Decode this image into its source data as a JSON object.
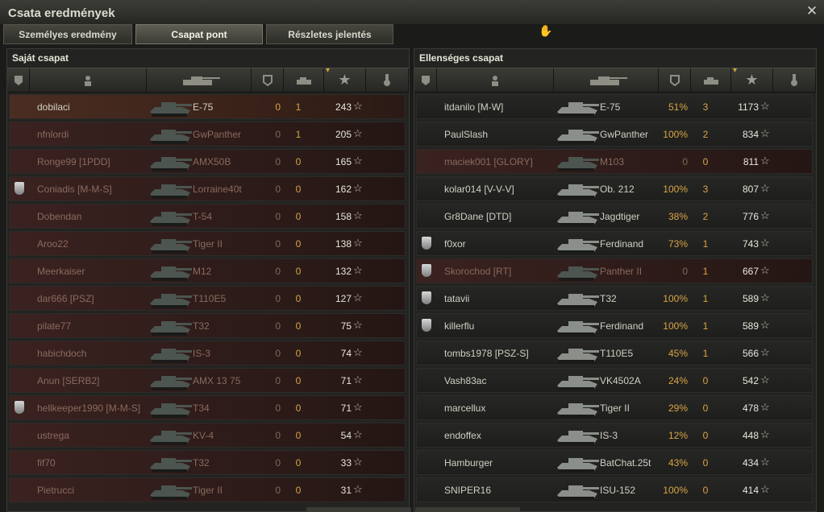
{
  "window": {
    "title": "Csata eredmények"
  },
  "tabs": [
    {
      "label": "Személyes eredmény"
    },
    {
      "label": "Csapat pont"
    },
    {
      "label": "Részletes jelentés"
    }
  ],
  "own_team": {
    "title": "Saját csapat",
    "rows": [
      {
        "player": "dobilaci",
        "tank": "E-75",
        "pct": "0",
        "kills": "1",
        "points": "243"
      },
      {
        "player": "nfnlordi",
        "tank": "GwPanther",
        "pct": "0",
        "kills": "1",
        "points": "205"
      },
      {
        "player": "Ronge99 [1PDD]",
        "tank": "AMX50B",
        "pct": "0",
        "kills": "0",
        "points": "165"
      },
      {
        "player": "Coniadis [M-M-S]",
        "tank": "Lorraine40t",
        "pct": "0",
        "kills": "0",
        "points": "162"
      },
      {
        "player": "Dobendan",
        "tank": "T-54",
        "pct": "0",
        "kills": "0",
        "points": "158"
      },
      {
        "player": "Aroo22",
        "tank": "Tiger II",
        "pct": "0",
        "kills": "0",
        "points": "138"
      },
      {
        "player": "Meerkaiser",
        "tank": "M12",
        "pct": "0",
        "kills": "0",
        "points": "132"
      },
      {
        "player": "dar666 [PSZ]",
        "tank": "T110E5",
        "pct": "0",
        "kills": "0",
        "points": "127"
      },
      {
        "player": "pilate77",
        "tank": "T32",
        "pct": "0",
        "kills": "0",
        "points": "75"
      },
      {
        "player": "habichdoch",
        "tank": "IS-3",
        "pct": "0",
        "kills": "0",
        "points": "74"
      },
      {
        "player": "Anun [SERB2]",
        "tank": "AMX 13 75",
        "pct": "0",
        "kills": "0",
        "points": "71"
      },
      {
        "player": "hellkeeper1990 [M-M-S]",
        "tank": "T34",
        "pct": "0",
        "kills": "0",
        "points": "71"
      },
      {
        "player": "ustrega",
        "tank": "KV-4",
        "pct": "0",
        "kills": "0",
        "points": "54"
      },
      {
        "player": "fif70",
        "tank": "T32",
        "pct": "0",
        "kills": "0",
        "points": "33"
      },
      {
        "player": "Pietrucci",
        "tank": "Tiger II",
        "pct": "0",
        "kills": "0",
        "points": "31"
      }
    ]
  },
  "enemy_team": {
    "title": "Ellenséges csapat",
    "rows": [
      {
        "player": "itdanilo [M-W]",
        "tank": "E-75",
        "pct": "51%",
        "kills": "3",
        "points": "1173"
      },
      {
        "player": "PaulSlash",
        "tank": "GwPanther",
        "pct": "100%",
        "kills": "2",
        "points": "834"
      },
      {
        "player": "maciek001 [GLORY]",
        "tank": "M103",
        "pct": "0",
        "kills": "0",
        "points": "811"
      },
      {
        "player": "kolar014 [V-V-V]",
        "tank": "Ob. 212",
        "pct": "100%",
        "kills": "3",
        "points": "807"
      },
      {
        "player": "Gr8Dane [DTD]",
        "tank": "Jagdtiger",
        "pct": "38%",
        "kills": "2",
        "points": "776"
      },
      {
        "player": "f0xor",
        "tank": "Ferdinand",
        "pct": "73%",
        "kills": "1",
        "points": "743"
      },
      {
        "player": "Skorochod [RT]",
        "tank": "Panther II",
        "pct": "0",
        "kills": "1",
        "points": "667"
      },
      {
        "player": "tatavii",
        "tank": "T32",
        "pct": "100%",
        "kills": "1",
        "points": "589"
      },
      {
        "player": "killerflu",
        "tank": "Ferdinand",
        "pct": "100%",
        "kills": "1",
        "points": "589"
      },
      {
        "player": "tombs1978 [PSZ-S]",
        "tank": "T110E5",
        "pct": "45%",
        "kills": "1",
        "points": "566"
      },
      {
        "player": "Vash83ac",
        "tank": "VK4502A",
        "pct": "24%",
        "kills": "0",
        "points": "542"
      },
      {
        "player": "marcellux",
        "tank": "Tiger II",
        "pct": "29%",
        "kills": "0",
        "points": "478"
      },
      {
        "player": "endoffex",
        "tank": "IS-3",
        "pct": "12%",
        "kills": "0",
        "points": "448"
      },
      {
        "player": "Hamburger",
        "tank": "BatChat.25t",
        "pct": "43%",
        "kills": "0",
        "points": "434"
      },
      {
        "player": "SNIPER16",
        "tank": "ISU-152",
        "pct": "100%",
        "kills": "0",
        "points": "414"
      }
    ]
  }
}
